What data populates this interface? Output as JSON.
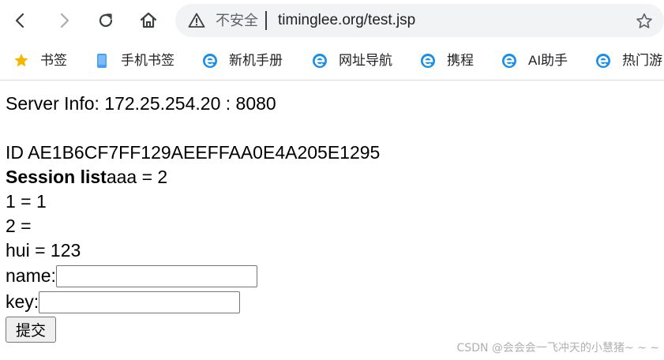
{
  "nav": {
    "back_icon": "back-arrow-icon",
    "forward_icon": "forward-arrow-icon",
    "reload_icon": "reload-icon",
    "home_icon": "home-icon"
  },
  "address_bar": {
    "security_label": "不安全",
    "url": "timinglee.org/test.jsp",
    "warning_icon": "warning-triangle-icon",
    "bookmark_icon": "star-outline-icon"
  },
  "bookmarks": [
    {
      "label": "书签",
      "icon": "star-icon",
      "color": "#f7b500"
    },
    {
      "label": "手机书签",
      "icon": "phone-icon",
      "color": "#4a9ef2"
    },
    {
      "label": "新机手册",
      "icon": "ie-icon",
      "color": "#1a8fe8"
    },
    {
      "label": "网址导航",
      "icon": "ie-icon",
      "color": "#1a8fe8"
    },
    {
      "label": "携程",
      "icon": "ie-icon",
      "color": "#1a8fe8"
    },
    {
      "label": "AI助手",
      "icon": "ie-icon",
      "color": "#1a8fe8"
    },
    {
      "label": "热门游",
      "icon": "ie-icon",
      "color": "#1a8fe8"
    }
  ],
  "page": {
    "server_info": "Server Info: 172.25.254.20 : 8080",
    "session_id": "ID AE1B6CF7FF129AEEFFAA0E4A205E1295",
    "session_list_label": "Session list",
    "session_list_first": "aaa = 2",
    "entries": [
      "1 = 1",
      "2 =",
      "hui = 123"
    ],
    "name_label": "name:",
    "name_value": "",
    "key_label": "key:",
    "key_value": "",
    "submit_label": "提交"
  },
  "watermark": "CSDN @会会会一飞冲天的小慧猪~ ~ ~"
}
